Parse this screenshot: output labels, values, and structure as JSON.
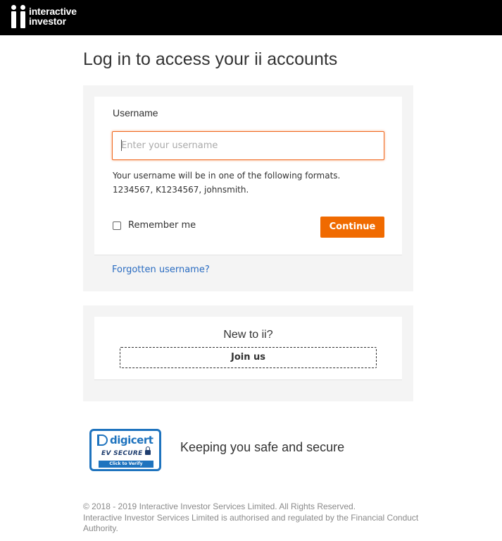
{
  "header": {
    "logo_line1": "interactive",
    "logo_line2": "investor"
  },
  "page_title": "Log in to access your ii accounts",
  "login": {
    "username_label": "Username",
    "username_value": "",
    "username_placeholder": "Enter your username",
    "help_line1": "Your username will be in one of the following formats.",
    "help_line2": "1234567, K1234567, johnsmith.",
    "remember_label": "Remember me",
    "remember_checked": false,
    "continue_label": "Continue",
    "forgot_label": "Forgotten username?"
  },
  "join": {
    "prompt": "New to ii?",
    "button_label": "Join us"
  },
  "security": {
    "seal_brand": "digicert",
    "seal_ev": "EV SECURE",
    "seal_verify": "Click to Verify",
    "tagline": "Keeping you safe and secure"
  },
  "footer": {
    "line1": "© 2018 - 2019 Interactive Investor Services Limited. All Rights Reserved.",
    "line2": "Interactive Investor Services Limited is authorised and regulated by the Financial Conduct Authority."
  },
  "colors": {
    "accent": "#f06a00",
    "link": "#2a6cc1",
    "header_bg": "#000000",
    "panel_bg": "#f4f4f4",
    "seal_blue": "#1e73be"
  }
}
